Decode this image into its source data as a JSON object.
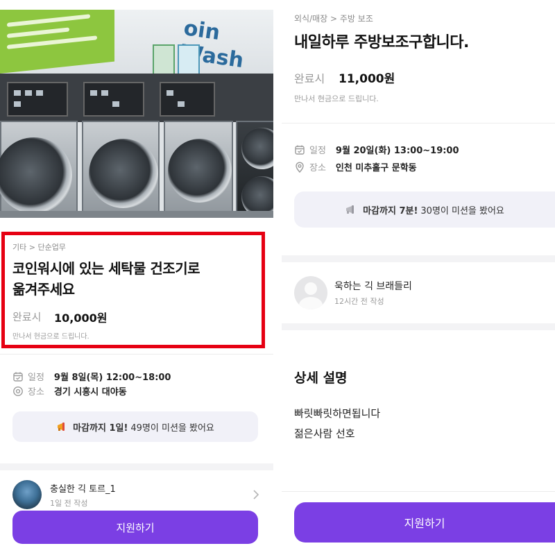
{
  "left": {
    "photo_sign_text": "oin Wash",
    "breadcrumb": "기타 > 단순업무",
    "title_line1": "코인워시에 있는 세탁물 건조기로",
    "title_line2": "옮겨주세요",
    "reward_label": "완료시",
    "reward_amount": "10,000원",
    "reward_note": "만나서 현금으로 드립니다.",
    "schedule_label": "일정",
    "schedule_value": "9월 8일(목) 12:00~18:00",
    "place_label": "장소",
    "place_value": "경기 시흥시 대야동",
    "notice_bold": "마감까지 1일!",
    "notice_text": "49명이 미션을 봤어요",
    "author_name": "충실한 긱 토르_1",
    "author_time": "1일 전 작성",
    "apply_label": "지원하기"
  },
  "right": {
    "breadcrumb": "외식/매장 > 주방 보조",
    "title": "내일하루 주방보조구합니다.",
    "reward_label": "완료시",
    "reward_amount": "11,000원",
    "reward_note": "만나서 현금으로 드립니다.",
    "schedule_label": "일정",
    "schedule_value": "9월 20일(화) 13:00~19:00",
    "place_label": "장소",
    "place_value": "인천 미추홀구 문학동",
    "notice_bold": "마감까지 7분!",
    "notice_text": "30명이 미션을 봤어요",
    "author_name": "욱하는 긱 브래들리",
    "author_time": "12시간 전 작성",
    "section_title": "상세 설명",
    "desc_line1": "빠릿빠릿하면됩니다",
    "desc_line2": "젊은사람 선호",
    "apply_label": "지원하기"
  },
  "colors": {
    "accent": "#7b3fe4",
    "highlight": "#e60012",
    "notice_bg": "#f1f1f8"
  },
  "icons": [
    "calendar-icon",
    "location-pin-icon",
    "megaphone-icon",
    "chevron-right-icon",
    "avatar-placeholder-icon"
  ]
}
